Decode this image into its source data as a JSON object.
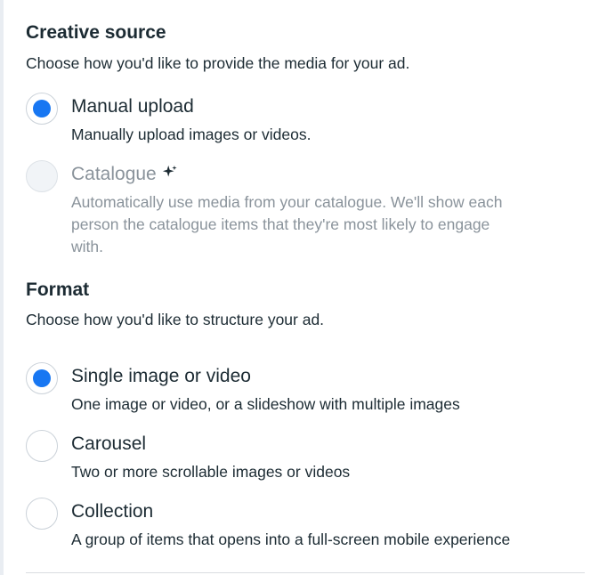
{
  "creative_source": {
    "title": "Creative source",
    "description": "Choose how you'd like to provide the media for your ad.",
    "options": [
      {
        "label": "Manual upload",
        "description": "Manually upload images or videos.",
        "selected": true,
        "disabled": false
      },
      {
        "label": "Catalogue",
        "icon": "sparkle-icon",
        "description_lines": [
          "Automatically use media from your catalogue. We'll show each",
          "person the catalogue items that they're most likely to engage",
          "with."
        ],
        "selected": false,
        "disabled": true
      }
    ]
  },
  "format": {
    "title": "Format",
    "description": "Choose how you'd like to structure your ad.",
    "options": [
      {
        "label": "Single image or video",
        "description": "One image or video, or a slideshow with multiple images",
        "selected": true
      },
      {
        "label": "Carousel",
        "description": "Two or more scrollable images or videos",
        "selected": false
      },
      {
        "label": "Collection",
        "description": "A group of items that opens into a full-screen mobile experience",
        "selected": false
      }
    ]
  },
  "colors": {
    "radio_selected": "#1877f2",
    "text_primary": "#1c2b33",
    "text_disabled": "#8a939b"
  }
}
